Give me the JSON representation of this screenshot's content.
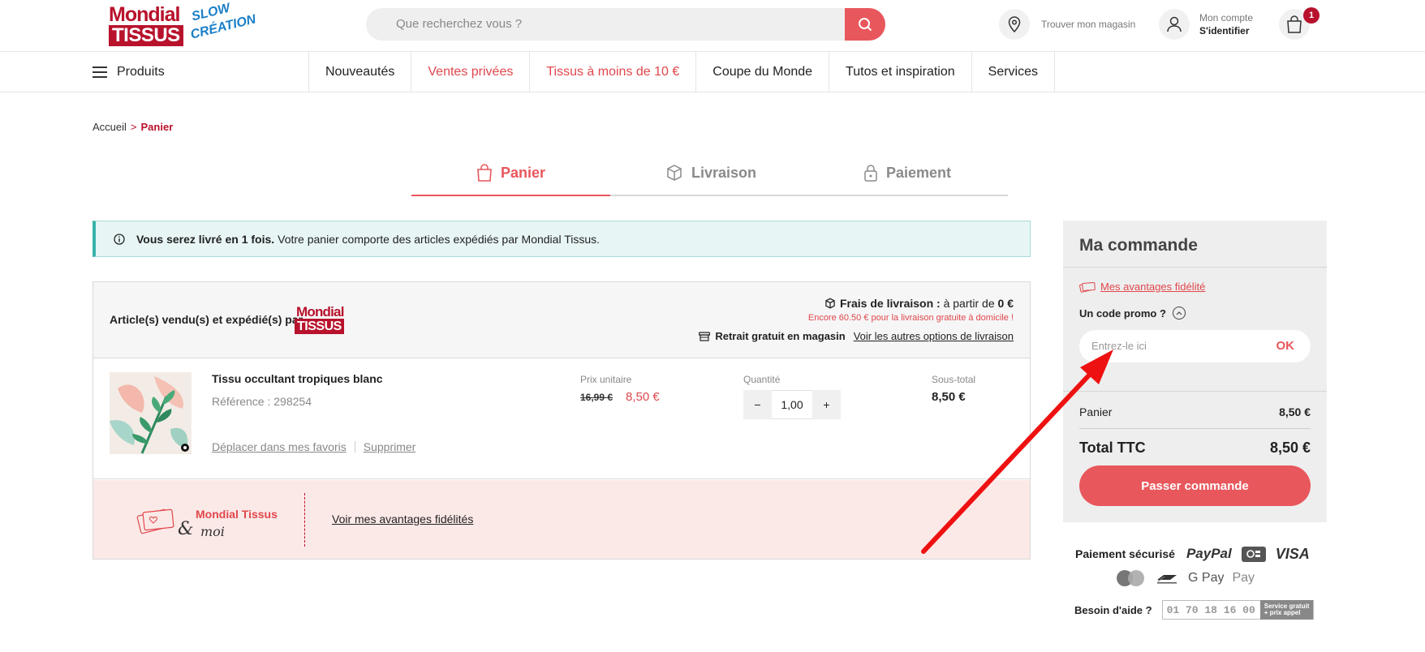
{
  "header": {
    "logo_line1": "Mondial",
    "logo_line2": "TISSUS",
    "logo_slow": "SLOW",
    "logo_creation": "CRÉATION",
    "search_placeholder": "Que recherchez vous ?",
    "store_label": "Trouver mon magasin",
    "account_top": "Mon compte",
    "account_bottom": "S'identifier",
    "cart_count": "1"
  },
  "nav": {
    "products": "Produits",
    "items": [
      "Nouveautés",
      "Ventes privées",
      "Tissus à moins de 10 €",
      "Coupe du Monde",
      "Tutos et inspiration",
      "Services"
    ]
  },
  "breadcrumb": {
    "home": "Accueil",
    "sep": ">",
    "current": "Panier"
  },
  "steps": [
    "Panier",
    "Livraison",
    "Paiement"
  ],
  "info": {
    "bold": "Vous serez livré en 1 fois.",
    "text": "Votre panier comporte des articles expédiés par Mondial Tissus."
  },
  "seller": {
    "label": "Article(s) vendu(s) et expédié(s) par",
    "logo_line1": "Mondial",
    "logo_line2": "TISSUS",
    "ship_label": "Frais de livraison :",
    "ship_from": "à partir de",
    "ship_price": "0 €",
    "free_note": "Encore 60.50 € pour la livraison gratuite à domicile !",
    "pickup": "Retrait gratuit en magasin",
    "other_options": "Voir les autres options de livraison"
  },
  "item": {
    "name": "Tissu occultant tropiques blanc",
    "ref": "Référence : 298254",
    "move_fav": "Déplacer dans mes favoris",
    "delete": "Supprimer",
    "unit_label": "Prix unitaire",
    "old_price": "16,99 €",
    "new_price": "8,50 €",
    "qty_label": "Quantité",
    "qty_minus": "−",
    "qty": "1,00",
    "qty_plus": "+",
    "subtotal_label": "Sous-total",
    "subtotal": "8,50 €"
  },
  "loyalty": {
    "brand": "Mondial Tissus",
    "amp": "&",
    "moi": "moi",
    "link": "Voir mes avantages fidélités"
  },
  "summary": {
    "title": "Ma commande",
    "fid_link": "Mes avantages fidélité",
    "promo_label": "Un code promo ?",
    "promo_placeholder": "Entrez-le ici",
    "promo_ok": "OK",
    "panier_label": "Panier",
    "panier_value": "8,50 €",
    "total_label": "Total TTC",
    "total_value": "8,50 €",
    "checkout": "Passer commande"
  },
  "footer": {
    "secure_label": "Paiement sécurisé",
    "paypal": "PayPal",
    "visa": "VISA",
    "gpay": "G Pay",
    "apay": " Pay",
    "help_label": "Besoin d'aide ?",
    "phone": "01 70 18 16 00",
    "phone_tag1": "Service gratuit",
    "phone_tag2": "+ prix appel"
  },
  "colors": {
    "brand_red": "#b8122c",
    "accent_coral": "#e8575c",
    "info_teal": "#39b3a8",
    "annotation_arrow": "#ee1111"
  }
}
